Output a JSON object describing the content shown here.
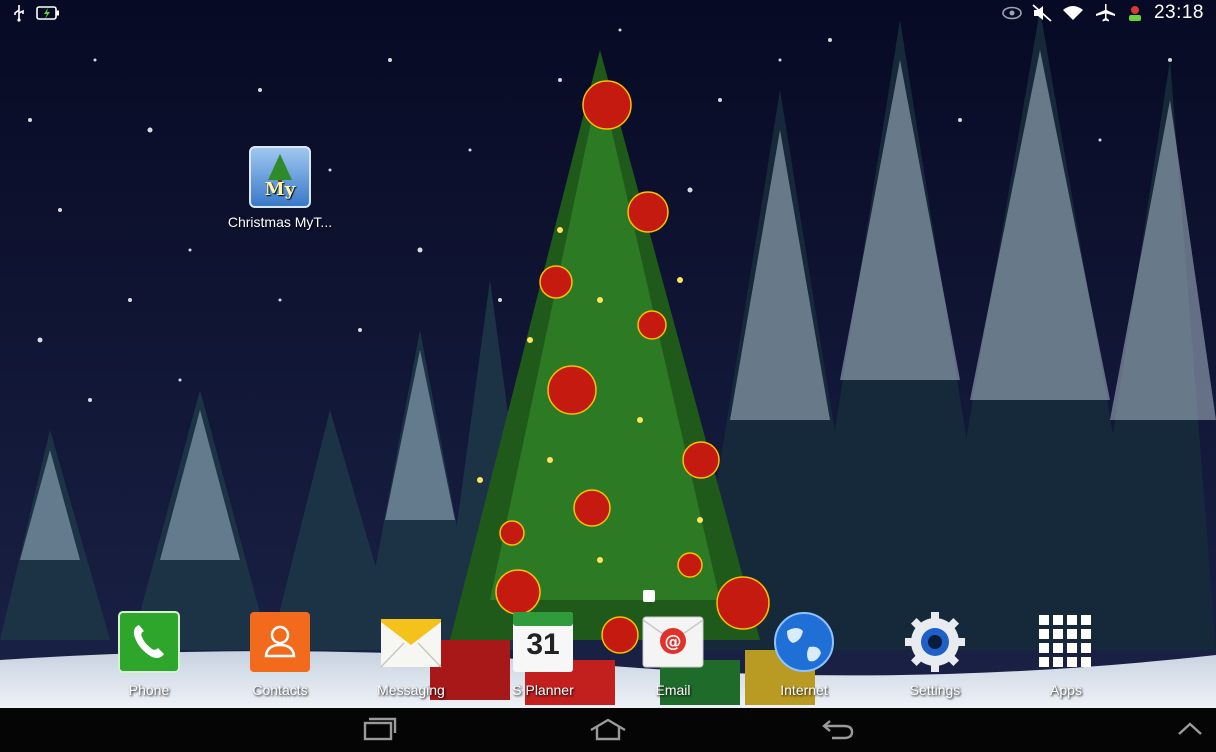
{
  "status_bar": {
    "time": "23:18",
    "left_icons": [
      "usb-icon",
      "battery-charging-icon"
    ],
    "right_icons": [
      "eye-icon",
      "mute-icon",
      "wifi-icon",
      "airplane-icon",
      "notification-person-icon"
    ]
  },
  "desktop": {
    "shortcut": {
      "label": "Christmas MyT...",
      "icon_text": "My",
      "icon": "christmas-tree-app-icon"
    }
  },
  "dock": {
    "items": [
      {
        "label": "Phone",
        "icon": "phone-icon"
      },
      {
        "label": "Contacts",
        "icon": "contacts-icon"
      },
      {
        "label": "Messaging",
        "icon": "messaging-icon"
      },
      {
        "label": "S Planner",
        "icon": "calendar-icon",
        "icon_text": "31"
      },
      {
        "label": "Email",
        "icon": "email-icon"
      },
      {
        "label": "Internet",
        "icon": "globe-icon"
      },
      {
        "label": "Settings",
        "icon": "settings-icon"
      },
      {
        "label": "Apps",
        "icon": "apps-grid-icon"
      }
    ]
  },
  "navbar": {
    "buttons": [
      "recent-apps-icon",
      "home-icon",
      "back-icon",
      "expand-up-icon"
    ]
  },
  "colors": {
    "sky": "#0b0e2e",
    "navbar": "#050505",
    "phone": "#2ea52b",
    "contacts": "#f26a1b",
    "calendar_header": "#2f9b3a"
  }
}
